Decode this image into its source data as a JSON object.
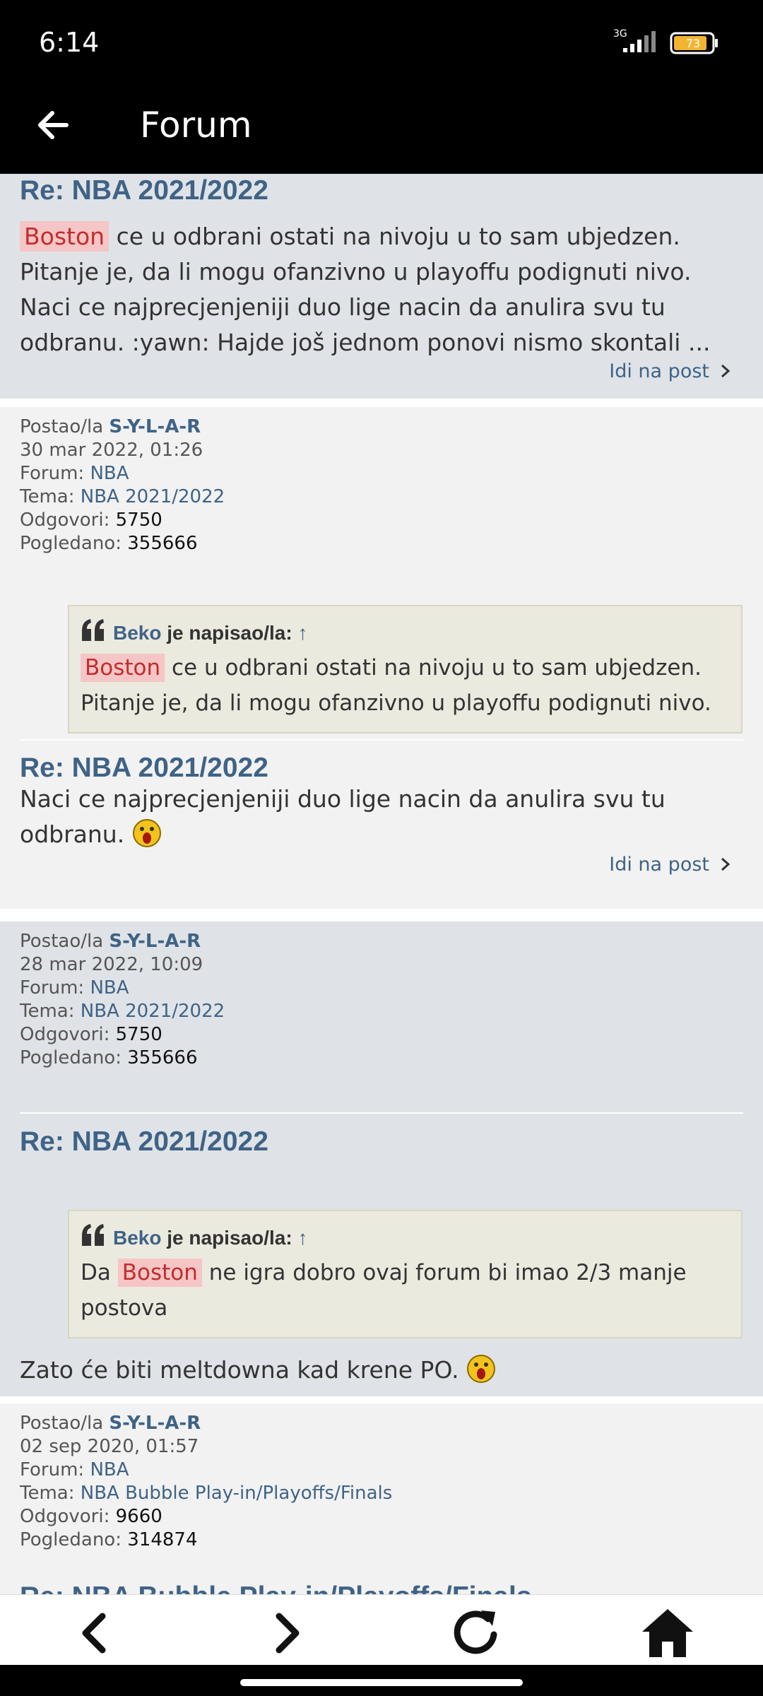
{
  "status_bar": {
    "time": "6:14",
    "network": "3G",
    "battery": "73"
  },
  "app_bar": {
    "title": "Forum",
    "back_icon": "arrow-left-icon"
  },
  "colors": {
    "link": "#3f6386",
    "highlight_bg": "#f6c5c5",
    "highlight_text": "#c12d2d",
    "card_gray": "#dfe3e7",
    "card_light": "#f2f2f2",
    "quote_bg": "#ebeadf"
  },
  "goto_label": "Idi na post",
  "meta_labels": {
    "posted_by": "Postao/la",
    "forum": "Forum:",
    "topic": "Tema:",
    "replies": "Odgovori:",
    "views": "Pogledano:"
  },
  "posts": [
    {
      "title": "Re: NBA 2021/2022",
      "text_highlight": "Boston",
      "text_rest": " ce u odbrani ostati na nivoju u to sam ubjedzen. Pitanje je, da li mogu ofanzivno u playoffu podignuti nivo. Naci ce najprecjenjeniji duo lige nacin da anulira svu tu odbranu. :yawn: Hajde još jednom ponovi nismo skontali ..."
    },
    {
      "author": "S-Y-L-A-R",
      "date": "30 mar 2022, 01:26",
      "forum": "NBA",
      "topic": "NBA 2021/2022",
      "replies": "5750",
      "views": "355666",
      "title": "Re: NBA 2021/2022",
      "quote": {
        "author": "Beko",
        "wrote": "je napisao/la:",
        "arrow": "↑",
        "highlight": "Boston",
        "text": " ce u odbrani ostati na nivoju u to sam ubjedzen. Pitanje je, da li mogu ofanzivno u playoffu podignuti nivo."
      },
      "reply": "Naci ce najprecjenjeniji duo lige nacin da anulira svu tu odbranu."
    },
    {
      "author": "S-Y-L-A-R",
      "date": "28 mar 2022, 10:09",
      "forum": "NBA",
      "topic": "NBA 2021/2022",
      "replies": "5750",
      "views": "355666",
      "title": "Re: NBA 2021/2022",
      "quote": {
        "author": "Beko",
        "wrote": "je napisao/la:",
        "arrow": "↑",
        "pre": "Da ",
        "highlight": "Boston",
        "text": " ne igra dobro ovaj forum bi imao 2/3 manje postova"
      },
      "reply": "Zato će biti meltdowna kad krene PO."
    },
    {
      "author": "S-Y-L-A-R",
      "date": "02 sep 2020, 01:57",
      "forum": "NBA",
      "topic": "NBA Bubble Play-in/Playoffs/Finals",
      "replies": "9660",
      "views": "314874",
      "title": "Re: NBA Bubble Play-in/Playoffs/Finals"
    }
  ],
  "bottom_nav": [
    "back-icon",
    "forward-icon",
    "refresh-icon",
    "home-icon"
  ]
}
